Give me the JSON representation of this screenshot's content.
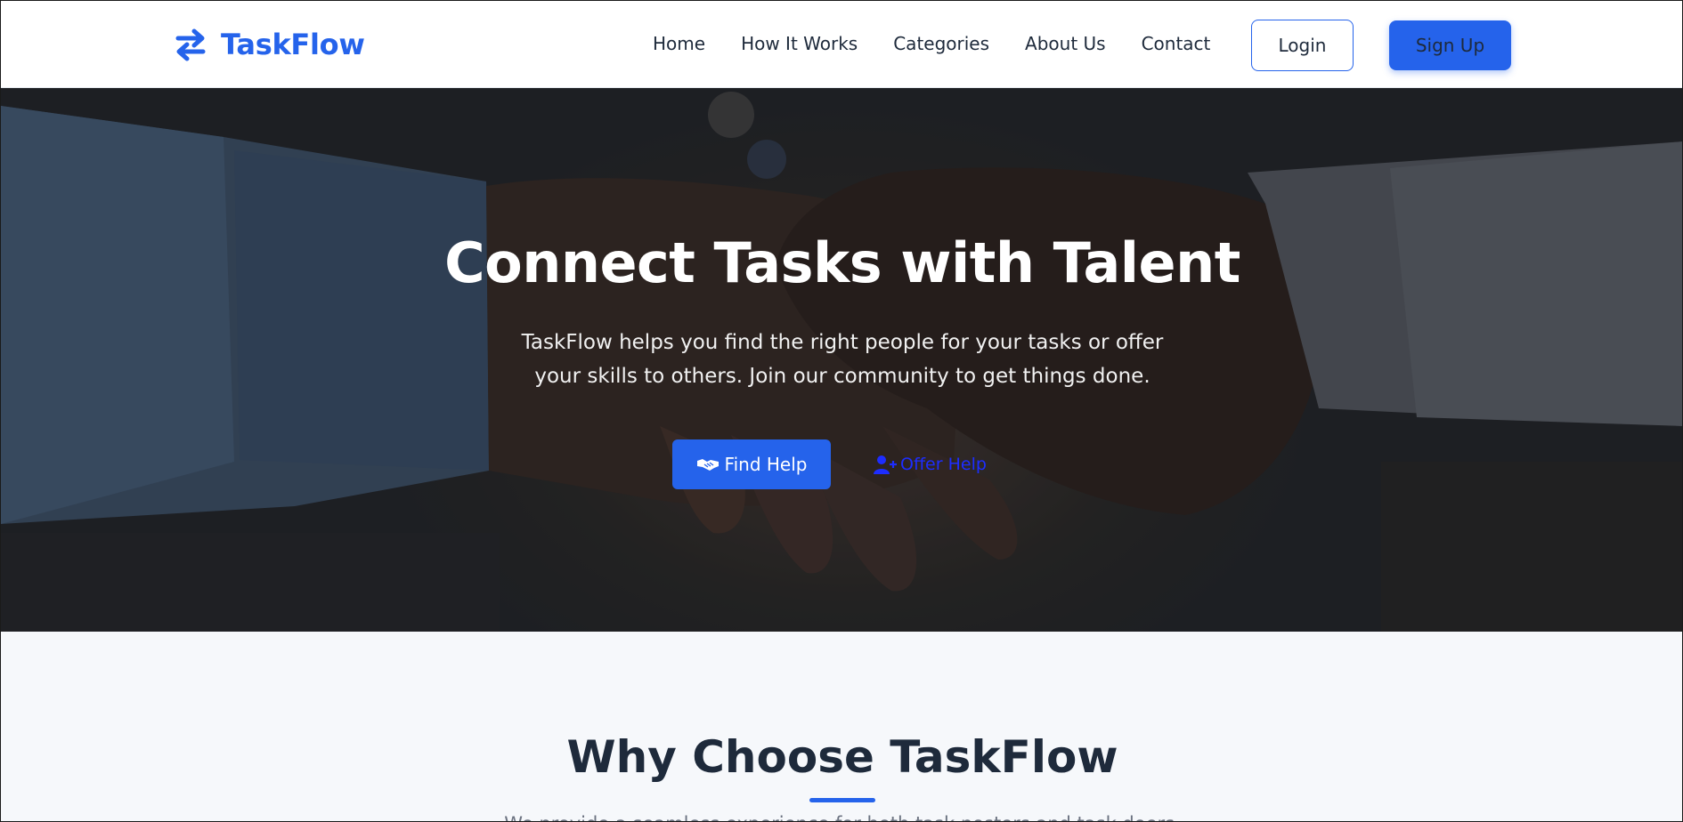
{
  "brand": {
    "name": "TaskFlow",
    "icon": "arrows-exchange-icon",
    "color": "#2563eb"
  },
  "nav": {
    "items": [
      {
        "label": "Home"
      },
      {
        "label": "How It Works"
      },
      {
        "label": "Categories"
      },
      {
        "label": "About Us"
      },
      {
        "label": "Contact"
      }
    ],
    "login_label": "Login",
    "signup_label": "Sign Up"
  },
  "hero": {
    "title": "Connect Tasks with Talent",
    "subtitle": "TaskFlow helps you find the right people for your tasks or offer your skills to others. Join our community to get things done.",
    "find_help": {
      "label": "Find Help",
      "icon": "handshake-icon"
    },
    "offer_help": {
      "label": "Offer Help",
      "icon": "user-plus-icon"
    }
  },
  "why": {
    "title": "Why Choose TaskFlow",
    "description": "We provide a seamless experience for both task posters and task doers."
  },
  "colors": {
    "accent": "#2563eb",
    "text_dark": "#1e2a3b",
    "section_bg": "#f6f8fb",
    "offer_link": "#1d2dff"
  }
}
